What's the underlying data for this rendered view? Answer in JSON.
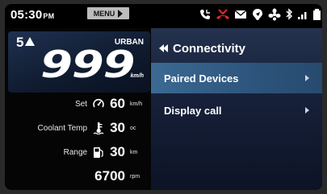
{
  "status": {
    "time": "05:30",
    "ampm": "PM",
    "menu_label": "MENU",
    "icons": [
      "phone-incoming-icon",
      "missed-call-icon",
      "message-icon",
      "navigation-icon",
      "fan-icon",
      "bluetooth-icon",
      "signal-icon",
      "battery-icon"
    ],
    "missed_call_color": "#e8282a"
  },
  "cluster": {
    "gear": "5",
    "mode": "URBAN",
    "speed": "999",
    "speed_unit": "km/h",
    "rows": [
      {
        "label": "Set",
        "icon": "cruise-icon",
        "value": "60",
        "unit": "km/h"
      },
      {
        "label": "Coolant Temp",
        "icon": "thermometer-icon",
        "value": "30",
        "unit": "oc"
      },
      {
        "label": "Range",
        "icon": "fuel-icon",
        "value": "30",
        "unit": "km"
      },
      {
        "label": "",
        "icon": "",
        "value": "6700",
        "unit": "rpm"
      }
    ]
  },
  "menu": {
    "title": "Connectivity",
    "items": [
      {
        "label": "Paired Devices",
        "selected": true
      },
      {
        "label": "Display call",
        "selected": false
      }
    ]
  },
  "colors": {
    "highlight": "#3b6a92",
    "panel": "#1a2540"
  }
}
